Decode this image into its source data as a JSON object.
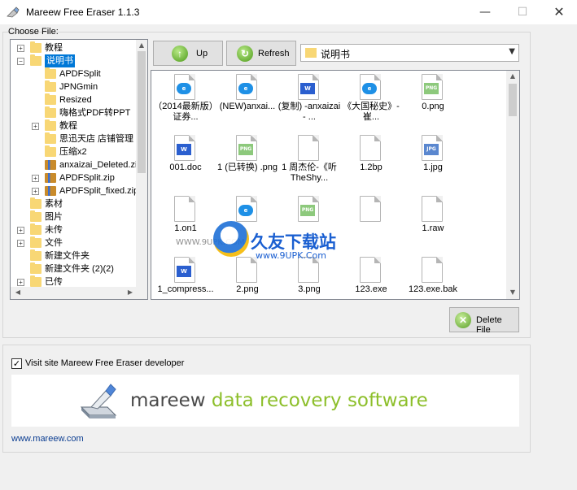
{
  "window": {
    "title": "Mareew Free Eraser 1.1.3",
    "minimize": "—",
    "maximize": "☐",
    "close": "✕"
  },
  "choose_file_label": "Choose File:",
  "tree": {
    "items": [
      {
        "label": "教程",
        "kind": "folder",
        "expander": "+",
        "level": 1
      },
      {
        "label": "说明书",
        "kind": "folder",
        "expander": "−",
        "level": 1,
        "selected": true
      },
      {
        "label": "APDFSplit",
        "kind": "folder",
        "expander": "",
        "level": 2
      },
      {
        "label": "JPNGmin",
        "kind": "folder",
        "expander": "",
        "level": 2
      },
      {
        "label": "Resized",
        "kind": "folder",
        "expander": "",
        "level": 2
      },
      {
        "label": "嗨格式PDF转PPT",
        "kind": "folder",
        "expander": "",
        "level": 2
      },
      {
        "label": "教程",
        "kind": "folder",
        "expander": "+",
        "level": 2
      },
      {
        "label": "思迅天店 店铺管理",
        "kind": "folder",
        "expander": "",
        "level": 2
      },
      {
        "label": "压缩x2",
        "kind": "folder",
        "expander": "",
        "level": 2
      },
      {
        "label": "anxaizai_Deleted.zip",
        "kind": "zip",
        "expander": "",
        "level": 2
      },
      {
        "label": "APDFSplit.zip",
        "kind": "zip",
        "expander": "+",
        "level": 2
      },
      {
        "label": "APDFSplit_fixed.zip",
        "kind": "zip",
        "expander": "+",
        "level": 2
      },
      {
        "label": "素材",
        "kind": "folder",
        "expander": "",
        "level": 1
      },
      {
        "label": "图片",
        "kind": "folder",
        "expander": "",
        "level": 1
      },
      {
        "label": "未传",
        "kind": "folder",
        "expander": "+",
        "level": 1
      },
      {
        "label": "文件",
        "kind": "folder",
        "expander": "+",
        "level": 1
      },
      {
        "label": "新建文件夹",
        "kind": "folder",
        "expander": "",
        "level": 1
      },
      {
        "label": "新建文件夹 (2)(2)",
        "kind": "folder",
        "expander": "",
        "level": 1
      },
      {
        "label": "已传",
        "kind": "folder",
        "expander": "+",
        "level": 1
      }
    ]
  },
  "toolbar": {
    "up_label": "Up",
    "refresh_label": "Refresh",
    "path_value": "说明书"
  },
  "files": [
    {
      "name": "（2014最新版）证券...",
      "type": "e"
    },
    {
      "name": "(NEW)anxai...",
      "type": "e"
    },
    {
      "name": "(复制) -anxaizai - ...",
      "type": "w"
    },
    {
      "name": "《大国秘史》-崔...",
      "type": "e"
    },
    {
      "name": "0.png",
      "type": "png"
    },
    {
      "name": "001.doc",
      "type": "w"
    },
    {
      "name": "1 (已转换) .png",
      "type": "png"
    },
    {
      "name": "1 周杰伦-《听TheShy...",
      "type": "blank"
    },
    {
      "name": "1.2bp",
      "type": "blank"
    },
    {
      "name": "1.jpg",
      "type": "jpg"
    },
    {
      "name": "1.on1",
      "type": "blank"
    },
    {
      "name": "",
      "type": "e"
    },
    {
      "name": "",
      "type": "png"
    },
    {
      "name": "",
      "type": "blank"
    },
    {
      "name": "1.raw",
      "type": "blank"
    },
    {
      "name": "1_compress...",
      "type": "w"
    },
    {
      "name": "2.png",
      "type": "blank"
    },
    {
      "name": "3.png",
      "type": "blank"
    },
    {
      "name": "123.exe",
      "type": "blank"
    },
    {
      "name": "123.exe.bak",
      "type": "blank"
    }
  ],
  "watermark": {
    "brand": "久友下载站",
    "url": "www.9UPK.Com",
    "small": "WWW.9UPK.COM"
  },
  "delete_label": "Delete File",
  "visit_checkbox": {
    "checked": true,
    "mark": "✓",
    "label": "Visit site Mareew Free Eraser developer"
  },
  "banner": {
    "part1": "mareew",
    "part2": "data recovery software"
  },
  "site_link": "www.mareew.com"
}
